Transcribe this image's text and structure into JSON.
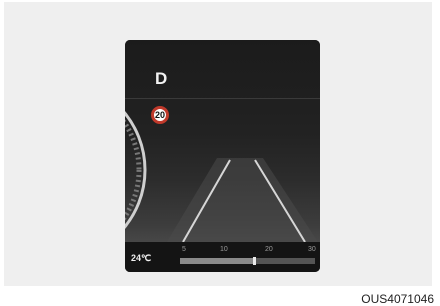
{
  "display": {
    "gear": "D",
    "speed_limit": "20",
    "temperature": "24℃",
    "scale_ticks": [
      "5",
      "10",
      "20",
      "30"
    ],
    "fuel_level": 0.55
  },
  "caption": "OUS4071046"
}
